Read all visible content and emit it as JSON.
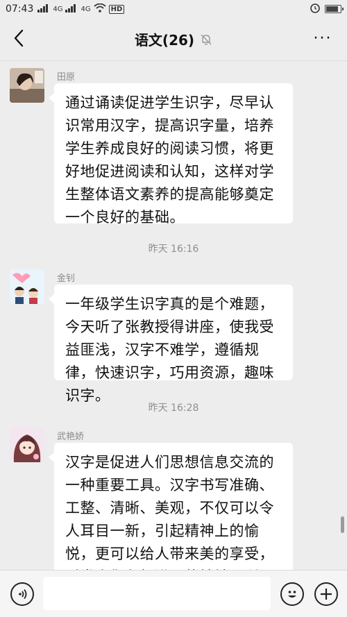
{
  "status_bar": {
    "time": "07:43",
    "signal_1": "4G",
    "signal_2": "4G",
    "hd_label": "HD",
    "battery_level": 0.85
  },
  "nav": {
    "title": "语文(26)",
    "back_icon": "chevron-left-icon",
    "mute_icon": "bell-off-icon",
    "more_label": "···"
  },
  "messages": [
    {
      "sender": "田原",
      "text": "通过诵读促进学生识字，尽早认识常用汉字，提高识字量，培养学生养成良好的阅读习惯，将更好地促进阅读和认知，这样对学生整体语文素养的提高能够奠定一个良好的基础。"
    },
    {
      "sender": "金钊",
      "text": "一年级学生识字真的是个难题，今天听了张教授得讲座，使我受益匪浅，汉字不难学，遵循规律，快速识字，巧用资源，趣味识字。"
    },
    {
      "sender": "武艳娇",
      "text": "汉字是促进人们思想信息交流的一种重要工具。汉字书写准确、工整、清晰、美观，不仅可以令人耳目一新，引起精神上的愉悦，更可以给人带来美的享受，引发人们积极进取的精神，所以写好汉字真的很重要"
    }
  ],
  "timestamps": [
    "昨天 16:16",
    "昨天 16:28"
  ],
  "input_bar": {
    "voice_icon": "voice-icon",
    "emoji_icon": "emoji-icon",
    "plus_icon": "plus-icon",
    "placeholder": ""
  }
}
